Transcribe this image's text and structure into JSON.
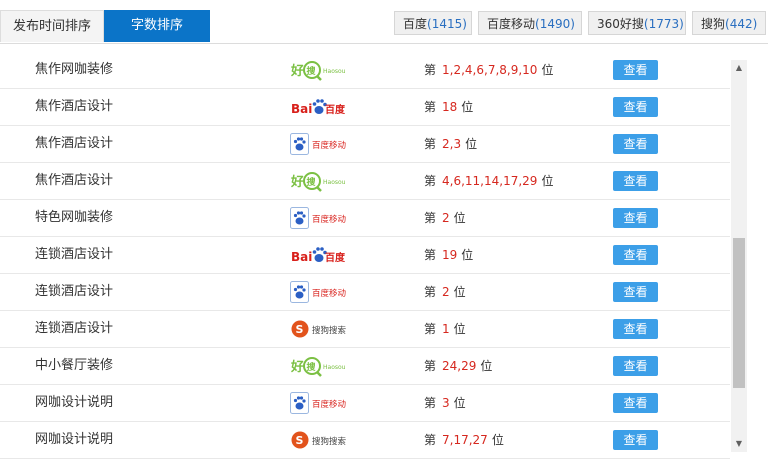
{
  "tabs": {
    "time": "发布时间排序",
    "count": "字数排序"
  },
  "filters": [
    {
      "name": "百度",
      "count": "(1415)"
    },
    {
      "name": "百度移动",
      "count": "(1490)"
    },
    {
      "name": "360好搜",
      "count": "(1773)"
    },
    {
      "name": "搜狗",
      "count": "(442)"
    }
  ],
  "labels": {
    "rank_prefix": "第",
    "rank_suffix": "位",
    "view": "查看"
  },
  "logos": {
    "haosou": {
      "cn": "好",
      "cn2": "搜",
      "en": "Haosou",
      "color": "#7bc043"
    },
    "baidu": {
      "en": "Bai",
      "cn": "百度",
      "color": "#d8201b",
      "paw_color": "#2b5fc4"
    },
    "baidu_mobile": {
      "cn": "百度移动",
      "color": "#d8201b"
    },
    "sogou": {
      "cn": "搜狗搜索",
      "color": "#e2531c"
    }
  },
  "rows": [
    {
      "keyword": "焦作网咖装修",
      "engine": "haosou",
      "rank": "1,2,4,6,7,8,9,10"
    },
    {
      "keyword": "焦作酒店设计",
      "engine": "baidu",
      "rank": "18"
    },
    {
      "keyword": "焦作酒店设计",
      "engine": "baidu_mobile",
      "rank": "2,3"
    },
    {
      "keyword": "焦作酒店设计",
      "engine": "haosou",
      "rank": "4,6,11,14,17,29"
    },
    {
      "keyword": "特色网咖装修",
      "engine": "baidu_mobile",
      "rank": "2"
    },
    {
      "keyword": "连锁酒店设计",
      "engine": "baidu",
      "rank": "19"
    },
    {
      "keyword": "连锁酒店设计",
      "engine": "baidu_mobile",
      "rank": "2"
    },
    {
      "keyword": "连锁酒店设计",
      "engine": "sogou",
      "rank": "1"
    },
    {
      "keyword": "中小餐厅装修",
      "engine": "haosou",
      "rank": "24,29"
    },
    {
      "keyword": "网咖设计说明",
      "engine": "baidu_mobile",
      "rank": "3"
    },
    {
      "keyword": "网咖设计说明",
      "engine": "sogou",
      "rank": "7,17,27"
    }
  ]
}
